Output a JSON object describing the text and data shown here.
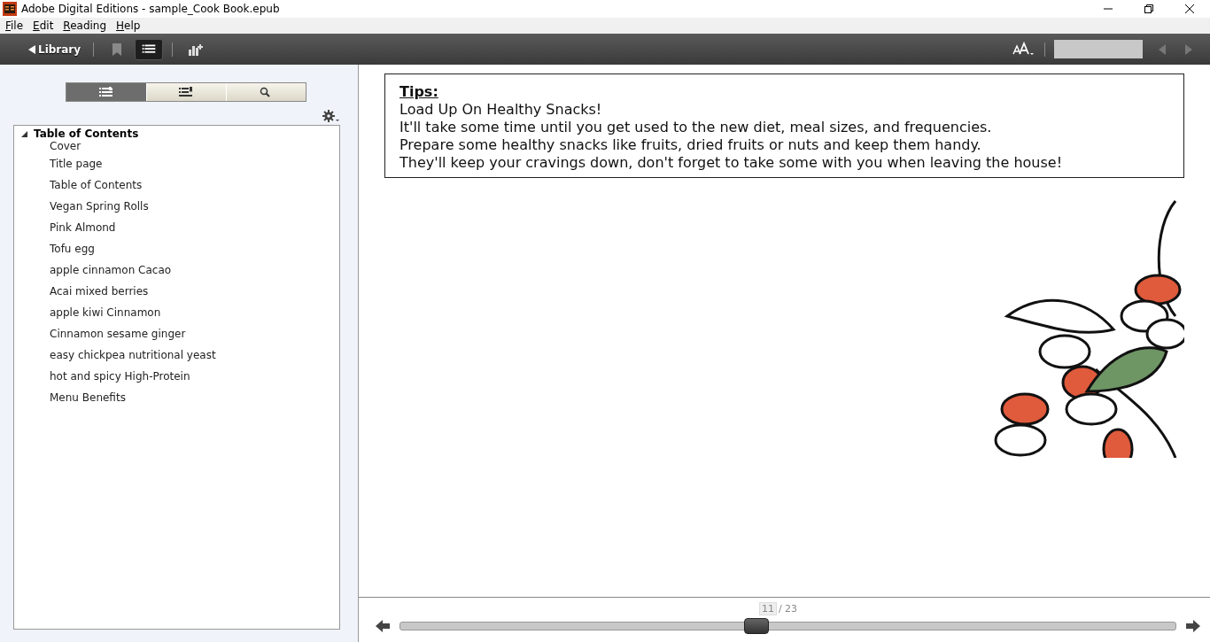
{
  "window": {
    "title": "Adobe Digital Editions - sample_Cook Book.epub"
  },
  "menu": [
    "File",
    "Edit",
    "Reading",
    "Help"
  ],
  "toolbar": {
    "library": "Library",
    "bookmark_selected": false,
    "toc_selected": true
  },
  "sidebar": {
    "tabs": [
      {
        "kind": "toc",
        "selected": true
      },
      {
        "kind": "bookmarks",
        "selected": false
      },
      {
        "kind": "search",
        "selected": false
      }
    ],
    "toc": {
      "title": "Table of Contents",
      "expanded": true,
      "children": [
        {
          "label": "Cover"
        },
        {
          "label": "Title page"
        },
        {
          "label": "Table of Contents"
        },
        {
          "label": "Vegan Spring Rolls"
        },
        {
          "label": "Pink Almond"
        },
        {
          "label": "Tofu egg"
        },
        {
          "label": "apple cinnamon Cacao"
        },
        {
          "label": "Acai mixed berries"
        },
        {
          "label": "apple kiwi Cinnamon"
        },
        {
          "label": "Cinnamon sesame ginger"
        },
        {
          "label": "easy chickpea nutritional yeast"
        },
        {
          "label": "hot and spicy High-Protein"
        },
        {
          "label": "Menu Benefits"
        }
      ]
    }
  },
  "page": {
    "tips_heading": "Tips:",
    "lines": [
      "Load Up On Healthy Snacks!",
      "It'll take some time until you get used to the new diet, meal sizes, and frequencies.",
      "Prepare some healthy snacks like fruits, dried fruits or nuts and keep them handy.",
      "They'll keep your cravings down, don't forget to take some with you when leaving the house!"
    ]
  },
  "footer": {
    "current_page": "11",
    "total": "/ 23",
    "level": 0.46
  }
}
